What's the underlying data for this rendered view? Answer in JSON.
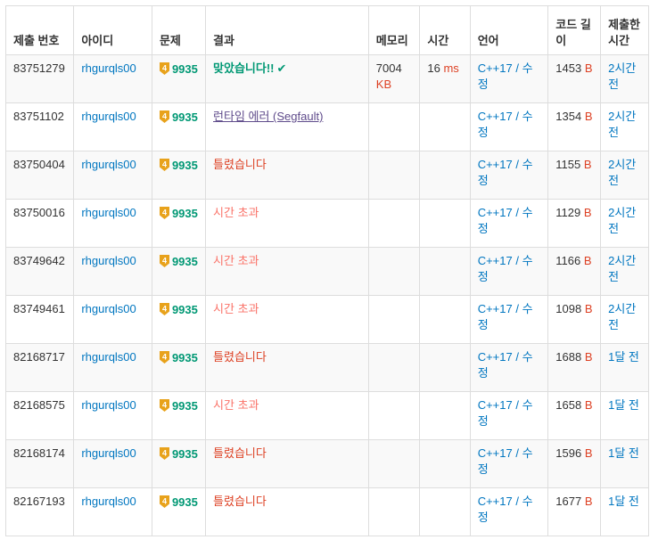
{
  "headers": {
    "submission_id": "제출 번호",
    "user_id": "아이디",
    "problem": "문제",
    "result": "결과",
    "memory": "메모리",
    "time": "시간",
    "language": "언어",
    "code_length": "코드 길이",
    "submitted": "제출한 시간"
  },
  "colors": {
    "accepted": "#009874",
    "wrong": "#dd4124",
    "tle": "#fa7268",
    "rte": "#5f4b8b",
    "link": "#0076c0",
    "badge": "#e8a21b"
  },
  "rows": [
    {
      "id": "83751279",
      "user": "rhgurqls00",
      "tier": "4",
      "problem": "9935",
      "result": "맞았습니다!!",
      "result_type": "ac",
      "memory": "7004",
      "memory_unit": "KB",
      "time": "16",
      "time_unit": "ms",
      "language": "C++17",
      "edit": "수정",
      "length": "1453",
      "length_unit": "B",
      "submitted": "2시간 전"
    },
    {
      "id": "83751102",
      "user": "rhgurqls00",
      "tier": "4",
      "problem": "9935",
      "result": "런타임 에러 (Segfault)",
      "result_type": "rte",
      "memory": "",
      "memory_unit": "",
      "time": "",
      "time_unit": "",
      "language": "C++17",
      "edit": "수정",
      "length": "1354",
      "length_unit": "B",
      "submitted": "2시간 전"
    },
    {
      "id": "83750404",
      "user": "rhgurqls00",
      "tier": "4",
      "problem": "9935",
      "result": "틀렸습니다",
      "result_type": "wa",
      "memory": "",
      "memory_unit": "",
      "time": "",
      "time_unit": "",
      "language": "C++17",
      "edit": "수정",
      "length": "1155",
      "length_unit": "B",
      "submitted": "2시간 전"
    },
    {
      "id": "83750016",
      "user": "rhgurqls00",
      "tier": "4",
      "problem": "9935",
      "result": "시간 초과",
      "result_type": "tle",
      "memory": "",
      "memory_unit": "",
      "time": "",
      "time_unit": "",
      "language": "C++17",
      "edit": "수정",
      "length": "1129",
      "length_unit": "B",
      "submitted": "2시간 전"
    },
    {
      "id": "83749642",
      "user": "rhgurqls00",
      "tier": "4",
      "problem": "9935",
      "result": "시간 초과",
      "result_type": "tle",
      "memory": "",
      "memory_unit": "",
      "time": "",
      "time_unit": "",
      "language": "C++17",
      "edit": "수정",
      "length": "1166",
      "length_unit": "B",
      "submitted": "2시간 전"
    },
    {
      "id": "83749461",
      "user": "rhgurqls00",
      "tier": "4",
      "problem": "9935",
      "result": "시간 초과",
      "result_type": "tle",
      "memory": "",
      "memory_unit": "",
      "time": "",
      "time_unit": "",
      "language": "C++17",
      "edit": "수정",
      "length": "1098",
      "length_unit": "B",
      "submitted": "2시간 전"
    },
    {
      "id": "82168717",
      "user": "rhgurqls00",
      "tier": "4",
      "problem": "9935",
      "result": "틀렸습니다",
      "result_type": "wa",
      "memory": "",
      "memory_unit": "",
      "time": "",
      "time_unit": "",
      "language": "C++17",
      "edit": "수정",
      "length": "1688",
      "length_unit": "B",
      "submitted": "1달 전"
    },
    {
      "id": "82168575",
      "user": "rhgurqls00",
      "tier": "4",
      "problem": "9935",
      "result": "시간 초과",
      "result_type": "tle",
      "memory": "",
      "memory_unit": "",
      "time": "",
      "time_unit": "",
      "language": "C++17",
      "edit": "수정",
      "length": "1658",
      "length_unit": "B",
      "submitted": "1달 전"
    },
    {
      "id": "82168174",
      "user": "rhgurqls00",
      "tier": "4",
      "problem": "9935",
      "result": "틀렸습니다",
      "result_type": "wa",
      "memory": "",
      "memory_unit": "",
      "time": "",
      "time_unit": "",
      "language": "C++17",
      "edit": "수정",
      "length": "1596",
      "length_unit": "B",
      "submitted": "1달 전"
    },
    {
      "id": "82167193",
      "user": "rhgurqls00",
      "tier": "4",
      "problem": "9935",
      "result": "틀렸습니다",
      "result_type": "wa",
      "memory": "",
      "memory_unit": "",
      "time": "",
      "time_unit": "",
      "language": "C++17",
      "edit": "수정",
      "length": "1677",
      "length_unit": "B",
      "submitted": "1달 전"
    }
  ]
}
